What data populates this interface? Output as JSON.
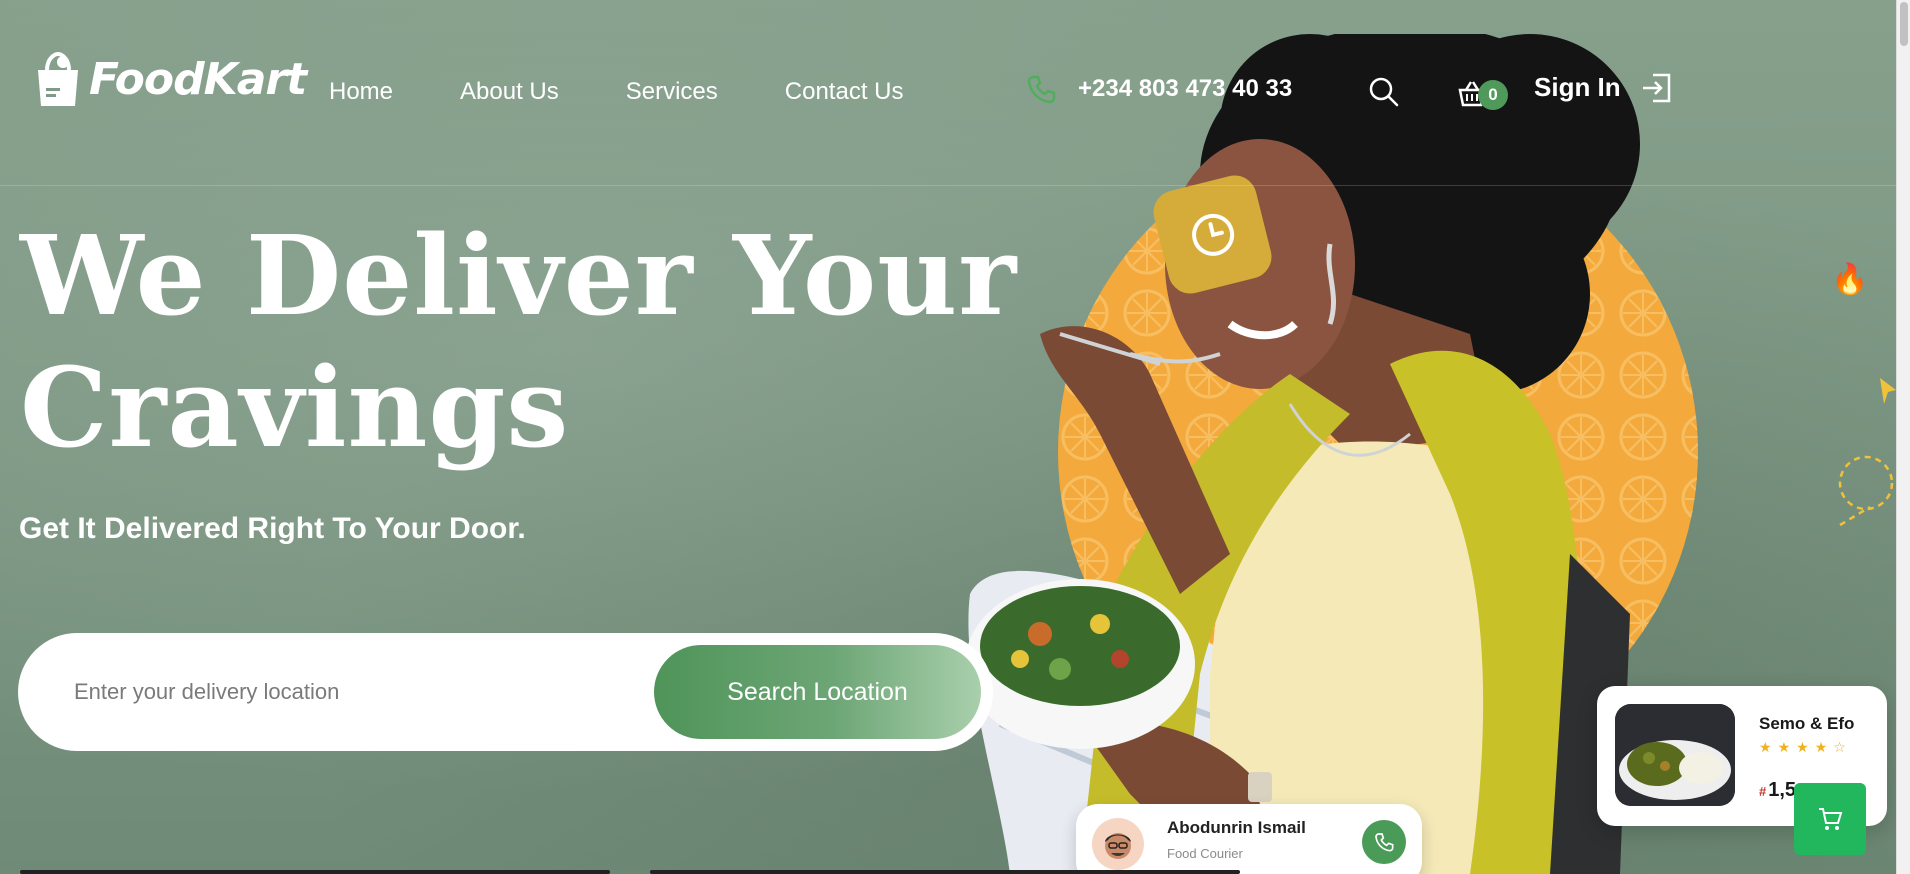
{
  "brand": {
    "name": "FoodKart"
  },
  "nav": {
    "items": [
      {
        "label": "Home"
      },
      {
        "label": "About Us"
      },
      {
        "label": "Services"
      },
      {
        "label": "Contact Us"
      }
    ]
  },
  "contact": {
    "phone": "+234 803 473 40 33",
    "icon": "phone-icon"
  },
  "cart": {
    "count": "0",
    "icon": "basket-icon"
  },
  "auth": {
    "signin_label": "Sign In",
    "icon": "login-icon"
  },
  "hero": {
    "headline_line1": "We Deliver Your",
    "headline_line2": "Cravings",
    "subheadline": "Get It Delivered Right To Your Door.",
    "search": {
      "placeholder": "Enter your delivery location",
      "value": "",
      "button_label": "Search Location"
    }
  },
  "product_card": {
    "name": "Semo & Efo",
    "rating": 4,
    "rating_max": 5,
    "price_symbol": "#",
    "price": "1,5"
  },
  "courier_card": {
    "name": "Abodunrin Ismail",
    "role": "Food Courier"
  },
  "colors": {
    "background": "#7f9a86",
    "accent_green": "#4f9459",
    "badge_green": "#4f9a5a",
    "cart_button": "#22b65d",
    "clock_badge": "#d5ac3a",
    "orange_circle": "#f3a93c"
  }
}
